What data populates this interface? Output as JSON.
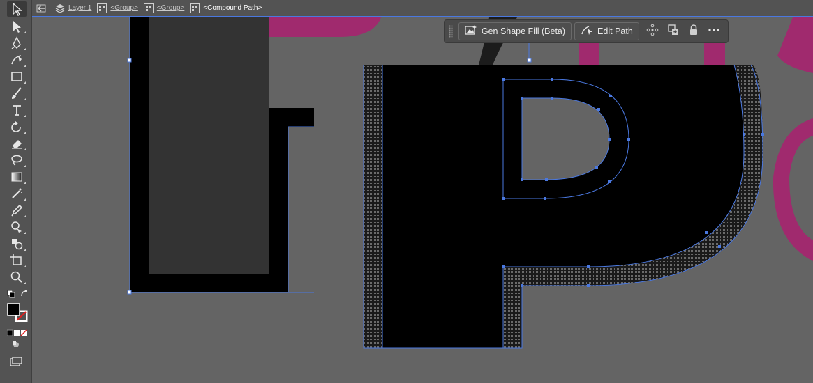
{
  "breadcrumb": {
    "back_icon": "back-arrow-icon",
    "items": [
      {
        "label": "Layer 1",
        "icon": "layers-icon"
      },
      {
        "label": "<Group>",
        "icon": "group-icon"
      },
      {
        "label": "<Group>",
        "icon": "group-icon"
      },
      {
        "label": "<Compound Path>",
        "icon": "compound-path-icon"
      }
    ]
  },
  "taskbar": {
    "gen_shape_fill_label": "Gen Shape Fill (Beta)",
    "edit_path_label": "Edit Path"
  },
  "toolbar": {
    "tools": [
      "selection-tool",
      "direct-selection-tool",
      "pen-tool",
      "curvature-tool",
      "rectangle-tool",
      "paintbrush-tool",
      "type-tool",
      "rotate-tool",
      "eraser-tool",
      "lasso-tool",
      "gradient-tool",
      "symbol-sprayer-tool",
      "eyedropper-tool",
      "shape-builder-tool",
      "blend-tool",
      "artboard-tool",
      "zoom-tool"
    ],
    "fill_color": "#000000",
    "stroke_color": "none"
  },
  "colors": {
    "magenta": "#a02a6e",
    "selection_blue": "#4a78e0",
    "canvas": "#646464"
  }
}
